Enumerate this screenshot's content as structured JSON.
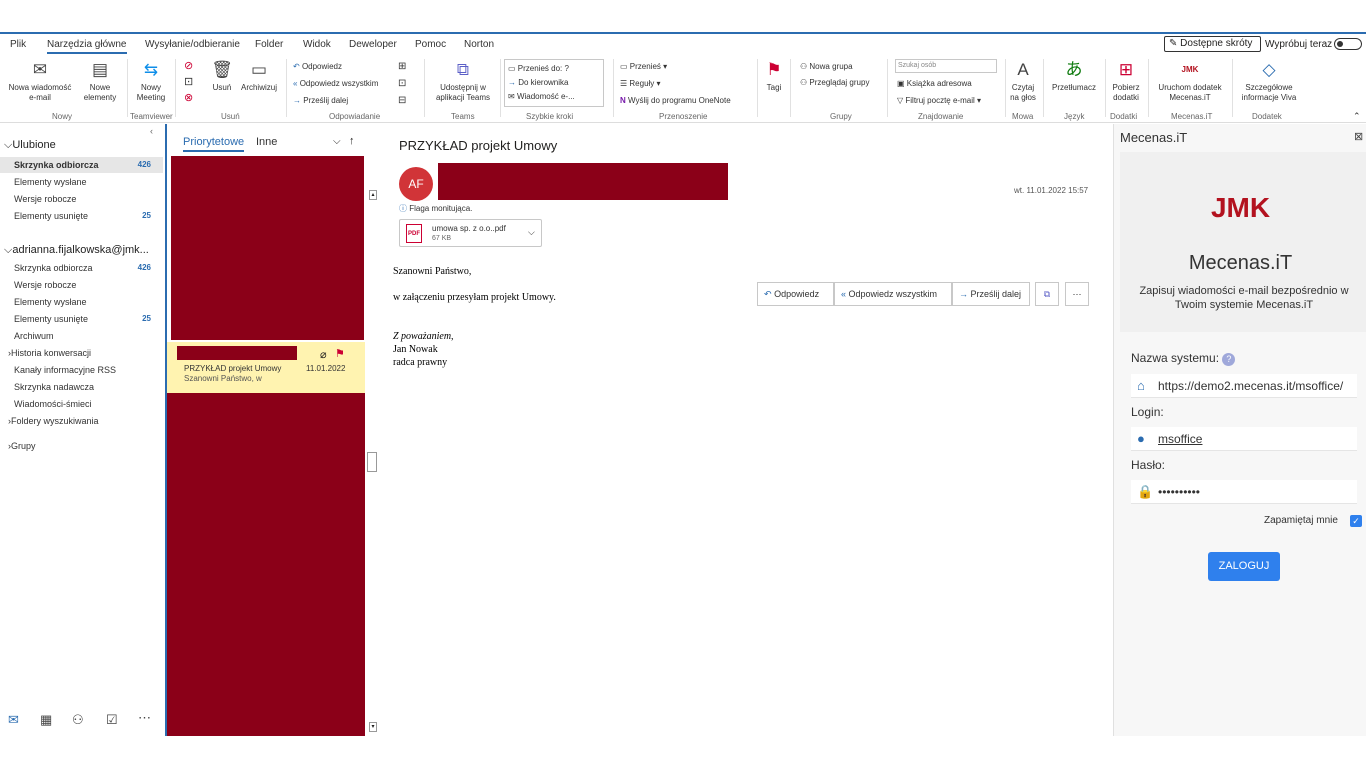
{
  "menu": {
    "tabs": [
      "Plik",
      "Narzędzia główne",
      "Wysyłanie/odbieranie",
      "Folder",
      "Widok",
      "Deweloper",
      "Pomoc",
      "Norton"
    ],
    "available_shortcuts": "Dostępne skróty",
    "try_now": "Wypróbuj teraz"
  },
  "ribbon": {
    "new_email": "Nowa wiadomość e-mail",
    "new_items": "Nowe elementy",
    "new_meeting": "Nowy Meeting",
    "delete": "Usuń",
    "archive": "Archiwizuj",
    "reply": "Odpowiedz",
    "reply_all": "Odpowiedz wszystkim",
    "forward": "Prześlij dalej",
    "share_teams": "Udostępnij w aplikacji Teams",
    "move_to": "Przenieś do: ?",
    "to_manager": "Do kierownika",
    "team_email": "Wiadomość e-...",
    "move": "Przenieś",
    "rules": "Reguły",
    "onenote": "Wyślij do programu OneNote",
    "tags": "Tagi",
    "new_group": "Nowa grupa",
    "browse_groups": "Przeglądaj grupy",
    "search_people": "Szukaj osób",
    "address_book": "Książka adresowa",
    "filter_email": "Filtruj pocztę e-mail",
    "read_aloud": "Czytaj na głos",
    "translate": "Przetłumacz",
    "get_addins": "Pobierz dodatki",
    "launch_addin": "Uruchom dodatek Mecenas.iT",
    "viva_details": "Szczegółowe informacje Viva",
    "groups": {
      "new": "Nowy",
      "teamviewer": "Teamviewer",
      "delete": "Usuń",
      "respond": "Odpowiadanie",
      "teams": "Teams",
      "quick_steps": "Szybkie kroki",
      "move": "Przenoszenie",
      "groups": "Grupy",
      "find": "Znajdowanie",
      "speech": "Mowa",
      "language": "Język",
      "addins": "Dodatki",
      "mecenas": "Mecenas.iT",
      "addin": "Dodatek"
    }
  },
  "nav": {
    "favorites": "Ulubione",
    "fav_items": [
      {
        "label": "Skrzynka odbiorcza",
        "count": "426"
      },
      {
        "label": "Elementy wysłane",
        "count": ""
      },
      {
        "label": "Wersje robocze",
        "count": ""
      },
      {
        "label": "Elementy usunięte",
        "count": "25"
      }
    ],
    "account": "adrianna.fijalkowska@jmk...",
    "acc_items": [
      {
        "label": "Skrzynka odbiorcza",
        "count": "426"
      },
      {
        "label": "Wersje robocze",
        "count": ""
      },
      {
        "label": "Elementy wysłane",
        "count": ""
      },
      {
        "label": "Elementy usunięte",
        "count": "25"
      },
      {
        "label": "Archiwum",
        "count": ""
      },
      {
        "label": "Historia konwersacji",
        "count": ""
      },
      {
        "label": "Kanały informacyjne RSS",
        "count": ""
      },
      {
        "label": "Skrzynka nadawcza",
        "count": ""
      },
      {
        "label": "Wiadomości-śmieci",
        "count": ""
      },
      {
        "label": "Foldery wyszukiwania",
        "count": ""
      }
    ],
    "groups": "Grupy"
  },
  "list": {
    "tab_focused": "Priorytetowe",
    "tab_other": "Inne",
    "selected": {
      "subject": "PRZYKŁAD projekt Umowy",
      "date": "11.01.2022",
      "preview": "Szanowni Państwo,  w"
    }
  },
  "message": {
    "subject": "PRZYKŁAD projekt Umowy",
    "avatar": "AF",
    "flag_note": "Flaga monitująca.",
    "reply": "Odpowiedz",
    "reply_all": "Odpowiedz wszystkim",
    "forward": "Prześlij dalej",
    "datetime": "wt. 11.01.2022 15:57",
    "attachment_name": "umowa sp. z o.o..pdf",
    "attachment_size": "67 KB",
    "greeting": "Szanowni Państwo,",
    "body": "w załączeniu przesyłam projekt Umowy.",
    "regards": "Z poważaniem,",
    "name": "Jan Nowak",
    "role": "radca prawny"
  },
  "addin": {
    "title": "Mecenas.iT",
    "logo": "JMK",
    "brand": "Mecenas.iT",
    "description": "Zapisuj wiadomości e-mail bezpośrednio w Twoim systemie Mecenas.iT",
    "system_label": "Nazwa systemu:",
    "system_value": "https://demo2.mecenas.it/msoffice/",
    "login_label": "Login:",
    "login_value": "msoffice",
    "password_label": "Hasło:",
    "password_value": "••••••••••",
    "remember": "Zapamiętaj mnie",
    "login_button": "ZALOGUJ"
  },
  "colors": {
    "accent": "#2b6cb0",
    "redact": "#8b0018",
    "brand_red": "#b3121f",
    "button": "#2f80ed"
  }
}
